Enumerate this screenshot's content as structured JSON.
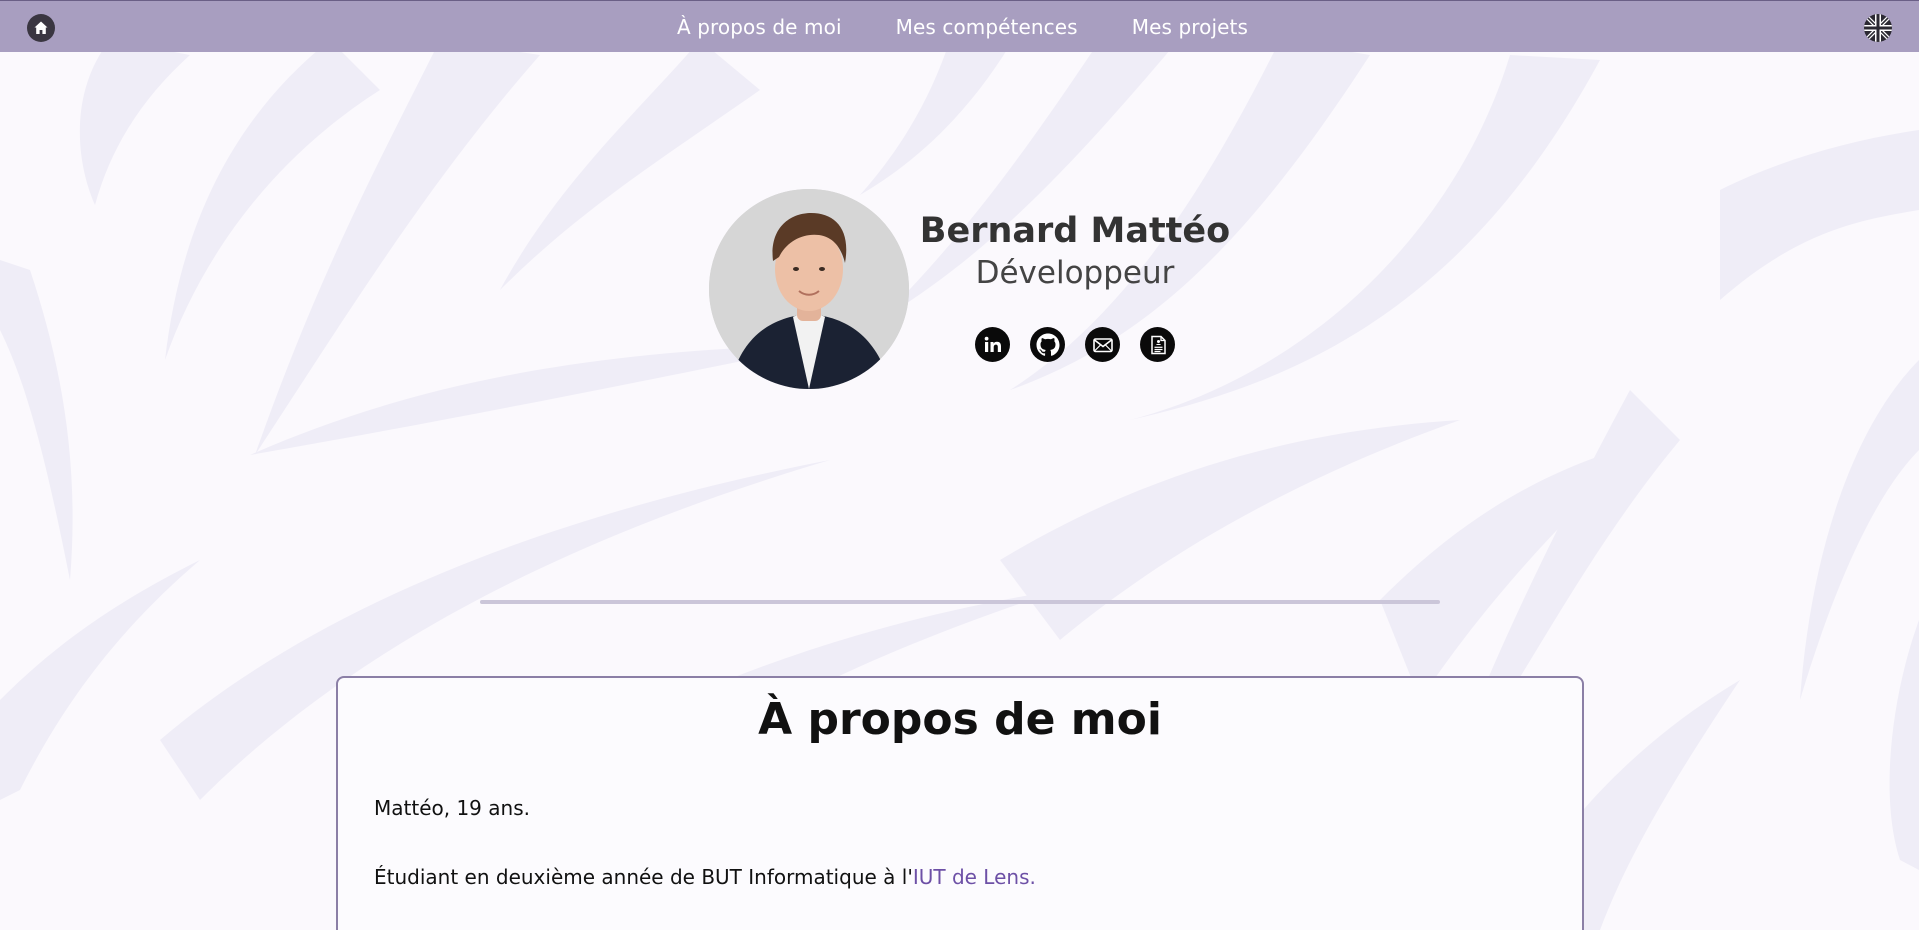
{
  "navbar": {
    "home_icon": "home-icon",
    "links": [
      {
        "label": "À propos de moi"
      },
      {
        "label": "Mes compétences"
      },
      {
        "label": "Mes projets"
      }
    ],
    "language_icon": "uk-flag-icon",
    "background_color": "#a89ec0"
  },
  "profile": {
    "name": "Bernard Mattéo",
    "role": "Développeur",
    "avatar_icon": "profile-photo",
    "socials": [
      {
        "icon": "linkedin-icon"
      },
      {
        "icon": "github-icon"
      },
      {
        "icon": "mail-icon"
      },
      {
        "icon": "cv-document-icon"
      }
    ]
  },
  "about": {
    "title": "À propos de moi",
    "intro": "Mattéo, 19 ans.",
    "study_prefix": "Étudiant en deuxième année de BUT Informatique à l'",
    "study_link": "IUT de Lens."
  },
  "theme": {
    "accent": "#6d50a6",
    "page_background": "#fbf9fd",
    "pattern_color": "#efedf7",
    "card_border": "#8b7fa6"
  }
}
